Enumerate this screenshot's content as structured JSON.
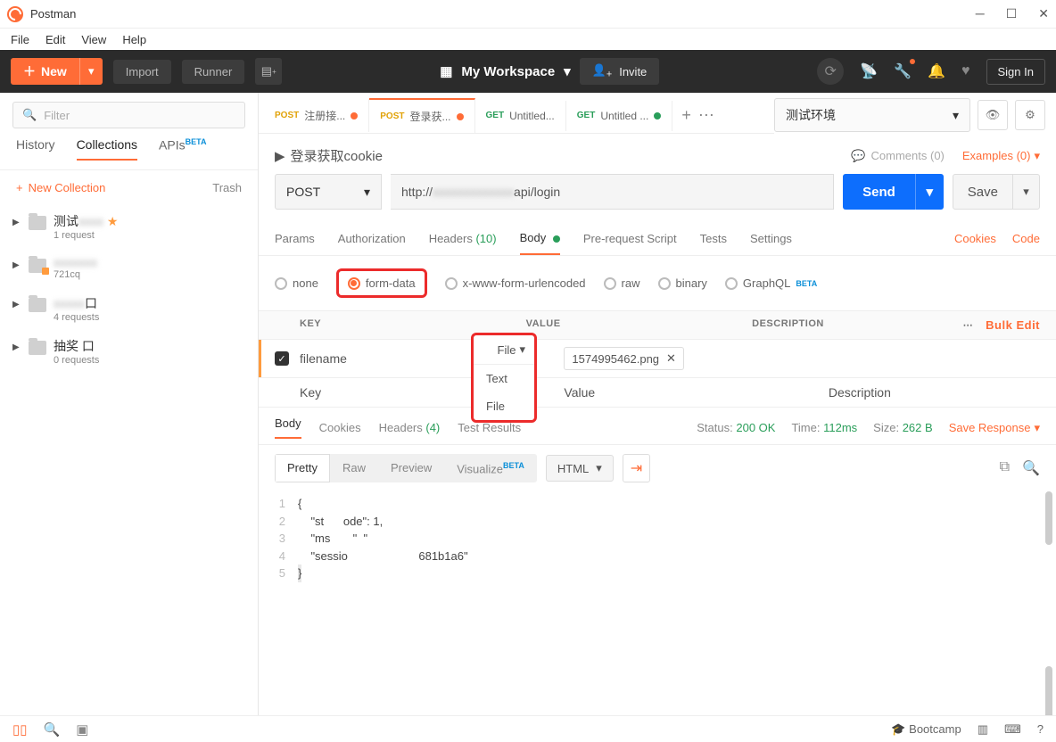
{
  "app": {
    "title": "Postman"
  },
  "menu": [
    "File",
    "Edit",
    "View",
    "Help"
  ],
  "toolbar": {
    "new": "New",
    "import": "Import",
    "runner": "Runner",
    "workspace": "My Workspace",
    "invite": "Invite",
    "signin": "Sign In"
  },
  "sidebar": {
    "filter_placeholder": "Filter",
    "tabs": {
      "history": "History",
      "collections": "Collections",
      "apis": "APIs",
      "beta": "BETA"
    },
    "new_collection": "New Collection",
    "trash": "Trash",
    "items": [
      {
        "name": "测试",
        "sub": "1 request",
        "starred": true
      },
      {
        "name": "721cq",
        "sub": "",
        "warn": true
      },
      {
        "name": "口",
        "sub": "4 requests"
      },
      {
        "name": "抽奖         口",
        "sub": "0 requests"
      }
    ]
  },
  "tabs": [
    {
      "method": "POST",
      "label": "注册接...",
      "dot": "orange"
    },
    {
      "method": "POST",
      "label": "登录获...",
      "dot": "orange",
      "active": true
    },
    {
      "method": "GET",
      "label": "Untitled..."
    },
    {
      "method": "GET",
      "label": "Untitled ...",
      "dot": "green"
    }
  ],
  "env": {
    "selected": "测试环境"
  },
  "crumb": {
    "title": "登录获取cookie",
    "comments": "Comments (0)",
    "examples": "Examples (0)"
  },
  "request": {
    "method": "POST",
    "url_prefix": "http://",
    "url_suffix": "api/login",
    "send": "Send",
    "save": "Save"
  },
  "subtabs": {
    "params": "Params",
    "auth": "Authorization",
    "headers": "Headers",
    "headers_count": "(10)",
    "body": "Body",
    "prereq": "Pre-request Script",
    "tests": "Tests",
    "settings": "Settings",
    "cookies": "Cookies",
    "code": "Code"
  },
  "body_types": {
    "none": "none",
    "formdata": "form-data",
    "xwww": "x-www-form-urlencoded",
    "raw": "raw",
    "binary": "binary",
    "graphql": "GraphQL",
    "beta": "BETA"
  },
  "kv": {
    "hdr_key": "KEY",
    "hdr_value": "VALUE",
    "hdr_desc": "DESCRIPTION",
    "bulk": "Bulk Edit",
    "rows": [
      {
        "checked": true,
        "key": "filename",
        "type": "File",
        "value": "1574995462.png"
      }
    ],
    "ph_key": "Key",
    "ph_value": "Value",
    "ph_desc": "Description",
    "type_opts": {
      "text": "Text",
      "file": "File"
    }
  },
  "response": {
    "tabs": {
      "body": "Body",
      "cookies": "Cookies",
      "headers": "Headers",
      "headers_count": "(4)",
      "tests": "Test Results"
    },
    "status_lbl": "Status:",
    "status_val": "200 OK",
    "time_lbl": "Time:",
    "time_val": "112ms",
    "size_lbl": "Size:",
    "size_val": "262 B",
    "save": "Save Response",
    "viewer": {
      "pretty": "Pretty",
      "raw": "Raw",
      "preview": "Preview",
      "visualize": "Visualize",
      "beta": "BETA",
      "format": "HTML"
    },
    "code": [
      "{",
      "    \"st      ode\": 1,",
      "    \"ms       \"  \"",
      "    \"sessio                      681b1a6\"",
      "}"
    ]
  },
  "footer": {
    "bootcamp": "Bootcamp"
  }
}
